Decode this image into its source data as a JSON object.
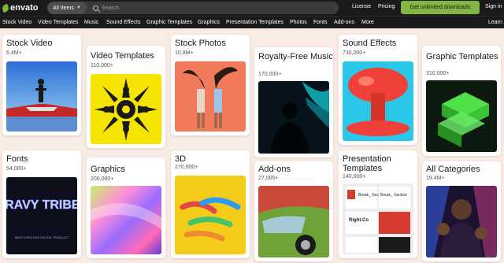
{
  "header": {
    "brand": "envato",
    "search": {
      "scope_label": "All Items",
      "placeholder": "Search"
    },
    "links": {
      "license": "License",
      "pricing": "Pricing",
      "signin": "Sign in"
    },
    "cta": "Get unlimited downloads"
  },
  "nav": {
    "items": [
      "Stock Video",
      "Video Templates",
      "Music",
      "Sound Effects",
      "Graphic Templates",
      "Graphics",
      "Presentation Templates",
      "Photos",
      "Fonts",
      "Add-ons",
      "More"
    ],
    "learn": "Learn"
  },
  "categories": [
    {
      "title": "Stock Video",
      "count": "6.4M+"
    },
    {
      "title": "Video Templates",
      "count": "110,000+"
    },
    {
      "title": "Stock Photos",
      "count": "10.8M+"
    },
    {
      "title": "Royalty-Free Music",
      "count": "170,000+"
    },
    {
      "title": "Sound Effects",
      "count": "730,000+"
    },
    {
      "title": "Graphic Templates",
      "count": "310,000+"
    },
    {
      "title": "Fonts",
      "count": "54,000+"
    },
    {
      "title": "Graphics",
      "count": "200,000+"
    },
    {
      "title": "3D",
      "count": "270,000+"
    },
    {
      "title": "Add-ons",
      "count": "27,000+"
    },
    {
      "title": "Presentation Templates",
      "count": "140,000+"
    },
    {
      "title": "All Categories",
      "count": "19.4M+"
    }
  ],
  "thumbs": {
    "fonts_art": "GRAVY TRIBES",
    "fonts_caption": "BEST CREATIVE DIGITAL PRODUCT",
    "pres_slide1": "Break_ Section",
    "pres_slide2": "Break_ Section",
    "pres_slide3": "Right.Co"
  },
  "colors": {
    "accent": "#82b541",
    "bar": "#1a1a1a",
    "page": "#f9ece4"
  }
}
